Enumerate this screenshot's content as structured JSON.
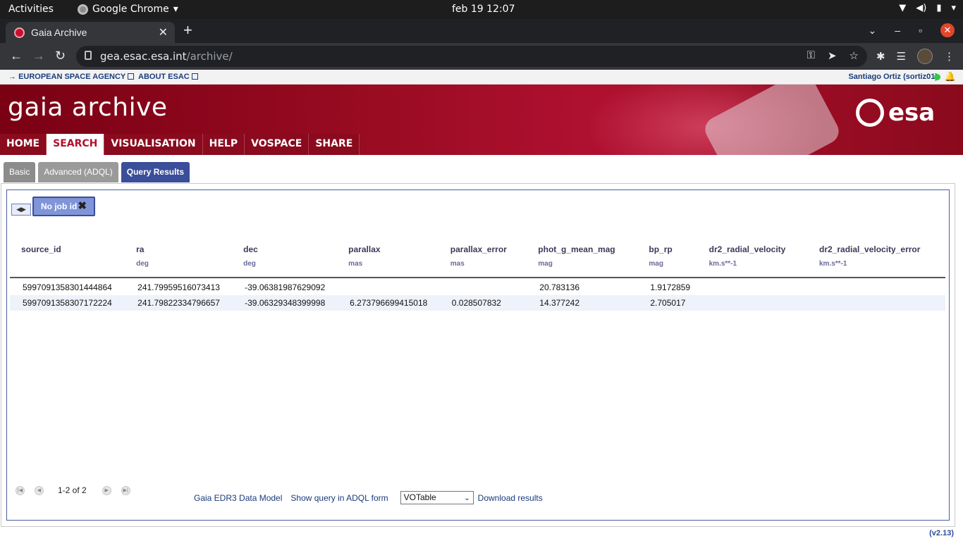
{
  "system_bar": {
    "activities": "Activities",
    "app_name": "Google Chrome",
    "clock": "feb 19  12:07"
  },
  "browser": {
    "tab_title": "Gaia Archive",
    "url_host": "gea.esac.esa.int",
    "url_path": "/archive/"
  },
  "esa_bar": {
    "link1": "EUROPEAN SPACE AGENCY",
    "link2": "ABOUT ESAC",
    "user": "Santiago Ortiz (sortiz01)"
  },
  "banner": {
    "title": "gaia archive",
    "logo_text": "esa"
  },
  "main_nav": [
    "HOME",
    "SEARCH",
    "VISUALISATION",
    "HELP",
    "VOSPACE",
    "SHARE"
  ],
  "main_nav_active": "SEARCH",
  "sub_tabs": [
    "Basic",
    "Advanced (ADQL)",
    "Query Results"
  ],
  "sub_tab_active": "Query Results",
  "job": {
    "label": "No job id"
  },
  "results": {
    "columns": [
      {
        "name": "source_id",
        "unit": ""
      },
      {
        "name": "ra",
        "unit": "deg"
      },
      {
        "name": "dec",
        "unit": "deg"
      },
      {
        "name": "parallax",
        "unit": "mas"
      },
      {
        "name": "parallax_error",
        "unit": "mas"
      },
      {
        "name": "phot_g_mean_mag",
        "unit": "mag"
      },
      {
        "name": "bp_rp",
        "unit": "mag"
      },
      {
        "name": "dr2_radial_velocity",
        "unit": "km.s**-1"
      },
      {
        "name": "dr2_radial_velocity_error",
        "unit": "km.s**-1"
      }
    ],
    "rows": [
      [
        "5997091358301444864",
        "241.79959516073413",
        "-39.06381987629092",
        "",
        "",
        "20.783136",
        "1.9172859",
        "",
        ""
      ],
      [
        "5997091358307172224",
        "241.79822334796657",
        "-39.06329348399998",
        "6.273796699415018",
        "0.028507832",
        "14.377242",
        "2.705017",
        "",
        ""
      ]
    ]
  },
  "pager": {
    "count": "1-2 of 2"
  },
  "footer": {
    "data_model": "Gaia EDR3 Data Model",
    "show_query": "Show query in ADQL form",
    "format_selected": "VOTable",
    "download": "Download results",
    "version": "(v2.13)"
  }
}
